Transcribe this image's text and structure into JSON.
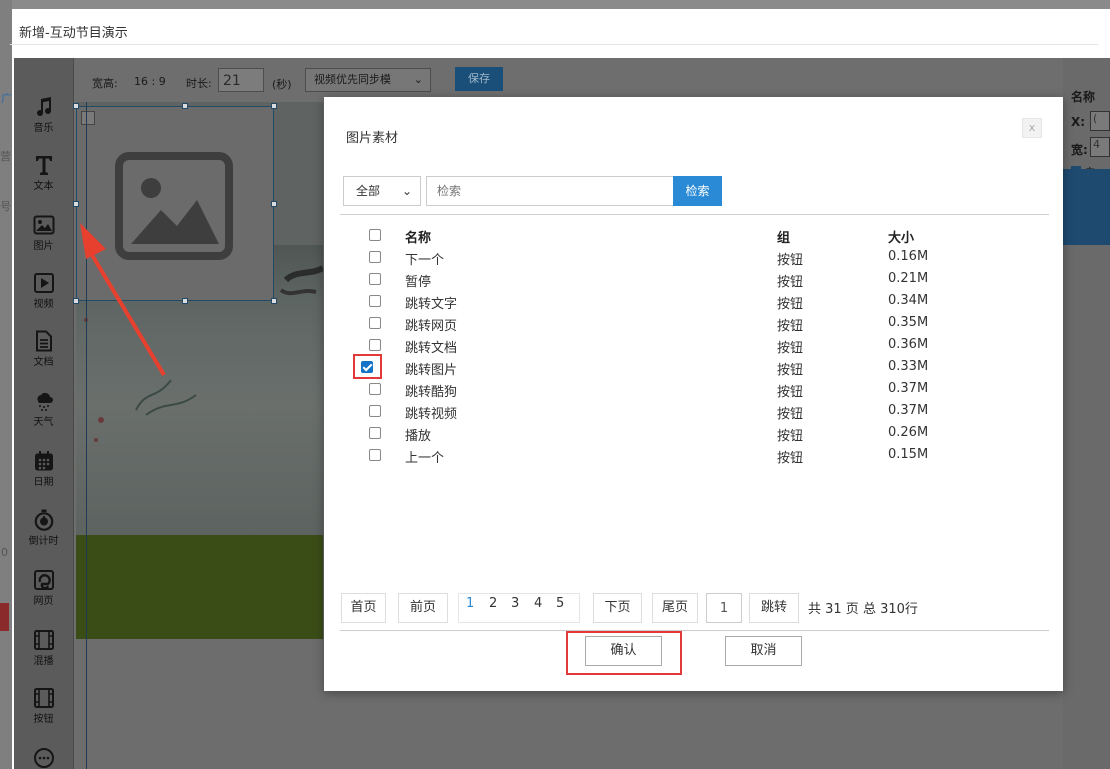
{
  "window": {
    "title": "新增-互动节目演示"
  },
  "edge_text": [
    "广",
    "营",
    "号",
    "0"
  ],
  "toolbox": [
    {
      "label": "音乐",
      "icon": "music-icon"
    },
    {
      "label": "文本",
      "icon": "text-icon"
    },
    {
      "label": "图片",
      "icon": "image-icon"
    },
    {
      "label": "视频",
      "icon": "video-icon"
    },
    {
      "label": "文档",
      "icon": "document-icon"
    },
    {
      "label": "天气",
      "icon": "weather-icon"
    },
    {
      "label": "日期",
      "icon": "calendar-icon"
    },
    {
      "label": "倒计时",
      "icon": "stopwatch-icon"
    },
    {
      "label": "网页",
      "icon": "webpage-icon"
    },
    {
      "label": "混播",
      "icon": "mixed-play-icon"
    },
    {
      "label": "按钮",
      "icon": "button-icon"
    },
    {
      "label": "",
      "icon": "more-icon"
    }
  ],
  "topbar": {
    "ratio_label": "宽高:",
    "ratio_value": "16 : 9",
    "duration_label": "时长:",
    "duration_value": "21",
    "duration_unit": "(秒)",
    "mode": "视频优先同步模",
    "save": "保存"
  },
  "right_panel": {
    "name_label": "名称",
    "x_label": "X:",
    "x_value": "(",
    "w_label": "宽:",
    "w_value": "4",
    "auto_label": "自"
  },
  "modal": {
    "title": "图片素材",
    "close": "x",
    "filter": {
      "selected": "全部"
    },
    "search": {
      "placeholder": "检索",
      "button": "检索"
    },
    "columns": {
      "name": "名称",
      "group": "组",
      "size": "大小"
    },
    "rows": [
      {
        "name": "下一个",
        "group": "按钮",
        "size": "0.16M",
        "checked": false
      },
      {
        "name": "暂停",
        "group": "按钮",
        "size": "0.21M",
        "checked": false
      },
      {
        "name": "跳转文字",
        "group": "按钮",
        "size": "0.34M",
        "checked": false
      },
      {
        "name": "跳转网页",
        "group": "按钮",
        "size": "0.35M",
        "checked": false
      },
      {
        "name": "跳转文档",
        "group": "按钮",
        "size": "0.36M",
        "checked": false
      },
      {
        "name": "跳转图片",
        "group": "按钮",
        "size": "0.33M",
        "checked": true
      },
      {
        "name": "跳转酷狗",
        "group": "按钮",
        "size": "0.37M",
        "checked": false
      },
      {
        "name": "跳转视频",
        "group": "按钮",
        "size": "0.37M",
        "checked": false
      },
      {
        "name": "播放",
        "group": "按钮",
        "size": "0.26M",
        "checked": false
      },
      {
        "name": "上一个",
        "group": "按钮",
        "size": "0.15M",
        "checked": false
      }
    ],
    "pagination": {
      "first": "首页",
      "prev": "前页",
      "pages": [
        "1",
        "2",
        "3",
        "4",
        "5"
      ],
      "current": "1",
      "next": "下页",
      "last": "尾页",
      "jump_value": "1",
      "jump": "跳转",
      "total_pages_text": "共 31 页 总 310行"
    },
    "confirm": "确认",
    "cancel": "取消"
  },
  "colors": {
    "accent": "#2a8ad6",
    "highlight": "#e23a3a",
    "checked": "#1273c7"
  }
}
